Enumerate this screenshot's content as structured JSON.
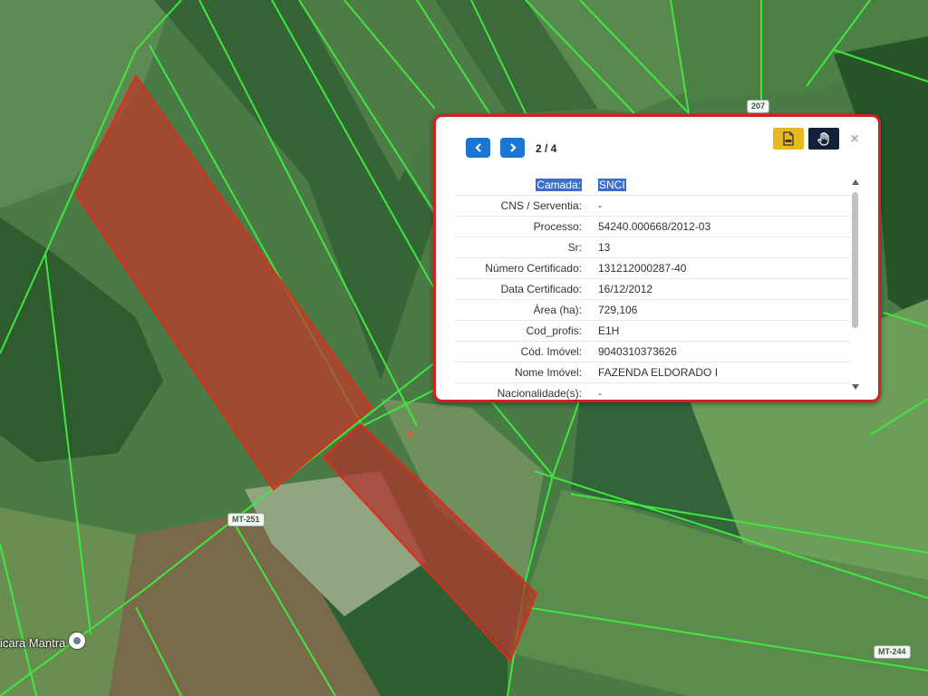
{
  "map": {
    "road_labels": [
      "MT-251",
      "MT-244",
      "207"
    ],
    "place_label": "icara Mantra",
    "parcel_color": "#c0392b",
    "boundary_color": "#3ee83e"
  },
  "popup": {
    "pager": "2 / 4",
    "prev_icon": "chevron-left-icon",
    "next_icon": "chevron-right-icon",
    "pdf_icon": "pdf-file-icon",
    "hand_icon": "hand-pan-icon",
    "close": "×",
    "accent": "#1976d2",
    "border_color": "#d81f1f",
    "rows": [
      {
        "label": "Camada:",
        "value": "SNCI"
      },
      {
        "label": "CNS / Serventia:",
        "value": "-"
      },
      {
        "label": "Processo:",
        "value": "54240.000668/2012-03"
      },
      {
        "label": "Sr:",
        "value": "13"
      },
      {
        "label": "Número Certificado:",
        "value": "131212000287-40"
      },
      {
        "label": "Data Certificado:",
        "value": "16/12/2012"
      },
      {
        "label": "Área (ha):",
        "value": "729,106"
      },
      {
        "label": "Cod_profis:",
        "value": "E1H"
      },
      {
        "label": "Cód. Imóvel:",
        "value": "9040310373626"
      },
      {
        "label": "Nome Imóvel:",
        "value": "FAZENDA ELDORADO I"
      },
      {
        "label": "Nacionalidade(s):",
        "value": "-"
      }
    ]
  }
}
